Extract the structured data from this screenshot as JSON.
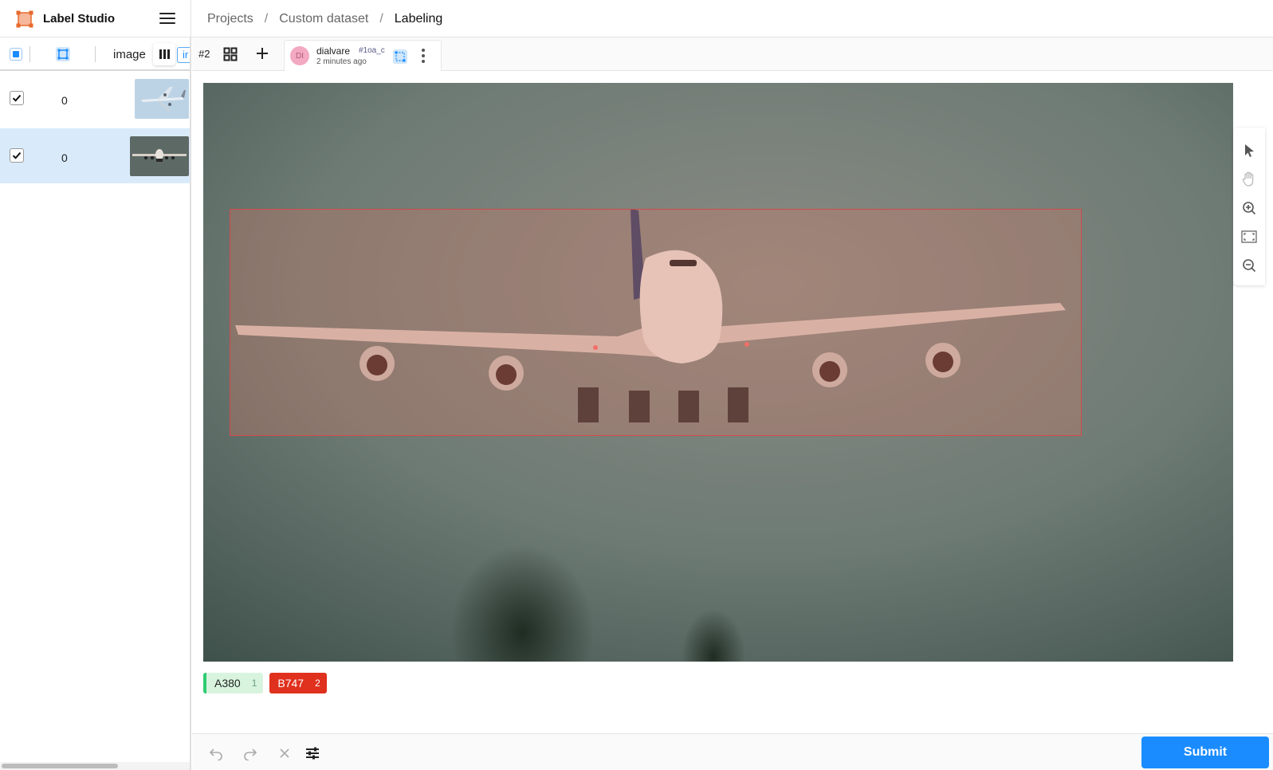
{
  "app": {
    "name": "Label Studio"
  },
  "breadcrumb": {
    "items": [
      "Projects",
      "Custom dataset",
      "Labeling"
    ],
    "separator": "/"
  },
  "data_manager": {
    "toolbar": {
      "column_label": "image",
      "tab_peek": "ir"
    },
    "rows": [
      {
        "checked": true,
        "count": "0",
        "selected": false
      },
      {
        "checked": true,
        "count": "0",
        "selected": true
      }
    ]
  },
  "labeling": {
    "task_id": "#2",
    "annotation": {
      "avatar": "DI",
      "user": "dialvare",
      "id": "#1oa_c",
      "time": "2 minutes ago"
    },
    "region": {
      "label": "B747",
      "color": "#e0301e"
    },
    "labels": [
      {
        "name": "A380",
        "hotkey": "1",
        "color": "#2ecc71",
        "active": false
      },
      {
        "name": "B747",
        "hotkey": "2",
        "color": "#e0301e",
        "active": true
      }
    ],
    "submit_label": "Submit"
  },
  "icons": [
    "menu-icon",
    "select-arrow-icon",
    "hand-pan-icon",
    "zoom-in-icon",
    "fit-zoom-icon",
    "zoom-out-icon",
    "undo-icon",
    "redo-icon",
    "reset-icon",
    "settings-sliders-icon",
    "grid-icon",
    "plus-icon",
    "kebab-icon",
    "bbox-tool-icon"
  ]
}
